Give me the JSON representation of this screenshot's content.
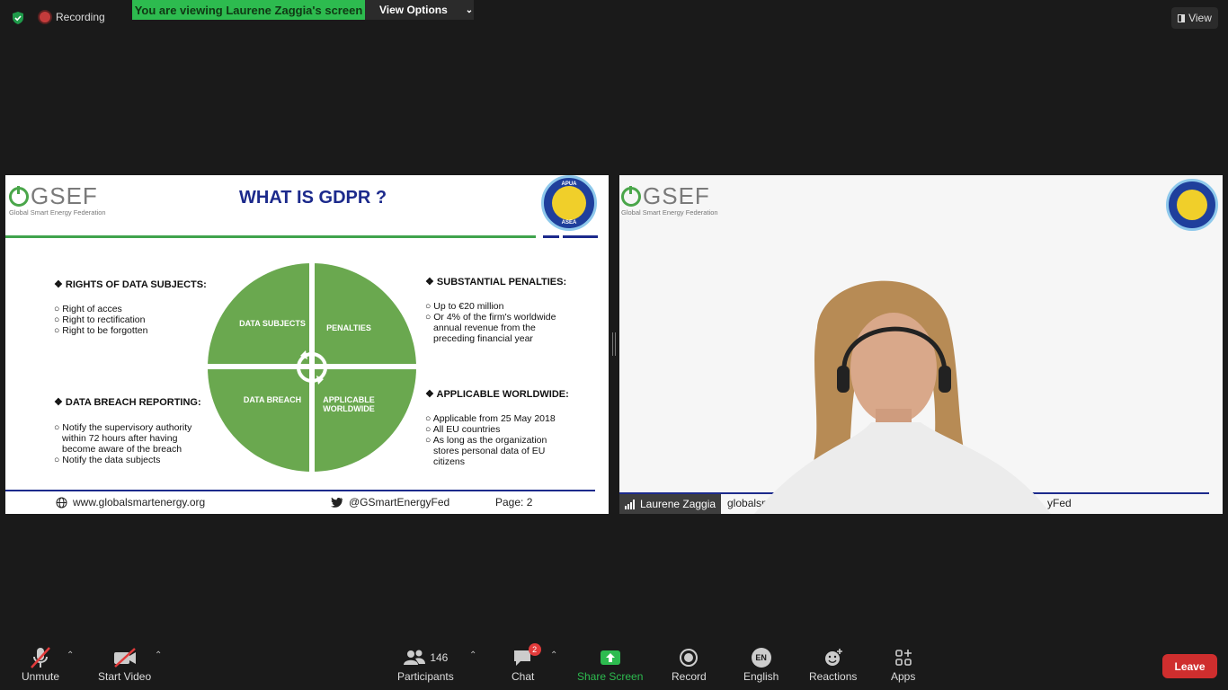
{
  "topbar": {
    "recording": "Recording",
    "viewing_banner": "You are viewing Laurene Zaggia's screen",
    "view_options": "View Options",
    "view": "View"
  },
  "slide": {
    "logo_text": "GSEF",
    "logo_sub": "Global Smart Energy Federation",
    "title": "WHAT IS GDPR ?",
    "badge_top": "APUA",
    "badge_bottom": "ASEA",
    "rights_heading": "❖ RIGHTS OF DATA SUBJECTS:",
    "rights": [
      "Right of acces",
      "Right to rectification",
      "Right to be forgotten"
    ],
    "breach_heading": "❖ DATA BREACH REPORTING:",
    "breach": [
      "Notify the supervisory authority within 72 hours after having become aware of the breach",
      "Notify the data subjects"
    ],
    "penalties_heading": "❖ SUBSTANTIAL PENALTIES:",
    "penalties": [
      "Up to €20 million",
      "Or 4% of the firm's worldwide annual revenue from the preceding financial year"
    ],
    "worldwide_heading": "❖ APPLICABLE WORLDWIDE:",
    "worldwide": [
      "Applicable from 25 May 2018",
      "All EU countries",
      "As long as the organization stores personal data of EU citizens"
    ],
    "quadrants": {
      "q1": "DATA SUBJECTS",
      "q2": "PENALTIES",
      "q3": "DATA BREACH",
      "q4": "APPLICABLE WORLDWIDE"
    },
    "footer_web": "www.globalsmartenergy.org",
    "footer_twitter": "@GSmartEnergyFed",
    "footer_page": "Page: 2"
  },
  "video": {
    "participant_name": "Laurene Zaggia",
    "logo_text": "GSEF",
    "logo_sub": "Global Smart Energy Federation",
    "footer_partial_left": "globalsm",
    "footer_partial_right": "yFed"
  },
  "toolbar": {
    "unmute": "Unmute",
    "start_video": "Start Video",
    "participants": "Participants",
    "participants_count": "146",
    "chat": "Chat",
    "chat_badge": "2",
    "share_screen": "Share Screen",
    "record": "Record",
    "language_code": "EN",
    "language": "English",
    "reactions": "Reactions",
    "apps": "Apps",
    "leave": "Leave"
  },
  "colors": {
    "share_green": "#2dbb4f",
    "leave_red": "#cf2e2e",
    "slide_green": "#6aa84f",
    "slide_blue": "#1c2a8c"
  }
}
